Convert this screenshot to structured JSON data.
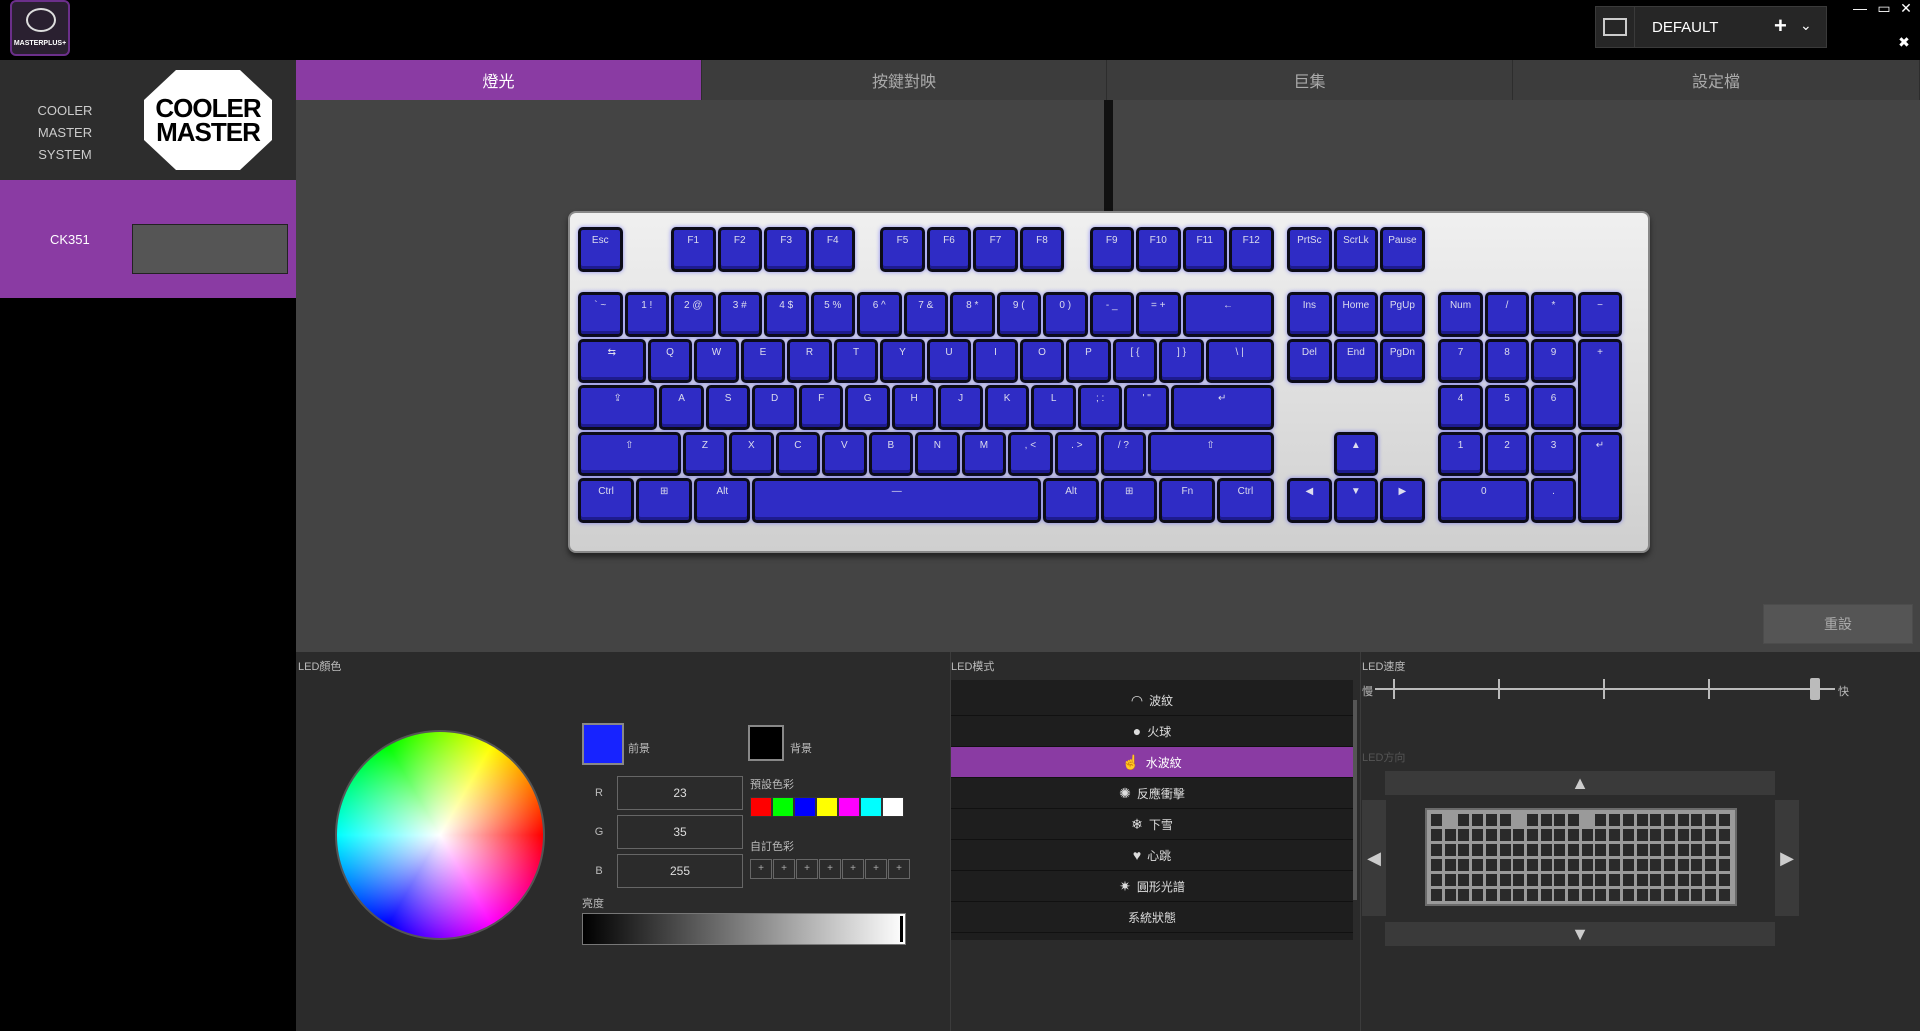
{
  "app": {
    "logo_text": "MASTERPLUS+"
  },
  "profile": {
    "name": "DEFAULT",
    "add": "+",
    "dropdown": "⌄"
  },
  "window": {
    "minimize": "—",
    "maximize": "▭",
    "close": "✕",
    "tools": "✖"
  },
  "sidebar": {
    "brand": {
      "text_line1": "COOLER MASTER",
      "text_line2": "SYSTEM",
      "logo_line1": "COOLER",
      "logo_line2": "MASTER"
    },
    "device": {
      "name": "CK351"
    }
  },
  "tabs": [
    {
      "label": "燈光"
    },
    {
      "label": "按鍵對映"
    },
    {
      "label": "巨集"
    },
    {
      "label": "設定檔"
    }
  ],
  "main": {
    "reset_label": "重設"
  },
  "keys": {
    "esc": "Esc",
    "f1": "F1",
    "f2": "F2",
    "f3": "F3",
    "f4": "F4",
    "f5": "F5",
    "f6": "F6",
    "f7": "F7",
    "f8": "F8",
    "f9": "F9",
    "f10": "F10",
    "f11": "F11",
    "f12": "F12",
    "prtsc": "PrtSc",
    "scrlk": "ScrLk",
    "pause": "Pause",
    "grave": "` ~",
    "n1": "1 !",
    "n2": "2 @",
    "n3": "3 #",
    "n4": "4 $",
    "n5": "5 %",
    "n6": "6 ^",
    "n7": "7 &",
    "n8": "8 *",
    "n9": "9 (",
    "n0": "0 )",
    "minus": "- _",
    "equal": "= +",
    "bksp": "←",
    "ins": "Ins",
    "home": "Home",
    "pgup": "PgUp",
    "num": "Num",
    "div": "/",
    "mul": "*",
    "sub": "−",
    "tab": "⇆",
    "q": "Q",
    "w": "W",
    "e": "E",
    "r": "R",
    "t": "T",
    "y": "Y",
    "u": "U",
    "i": "I",
    "o": "O",
    "p": "P",
    "lbr": "[ {",
    "rbr": "] }",
    "bsl": "\\ |",
    "del": "Del",
    "end": "End",
    "pgdn": "PgDn",
    "k7": "7",
    "k8": "8",
    "k9": "9",
    "add": "+",
    "caps": "⇪",
    "a": "A",
    "s": "S",
    "d": "D",
    "f": "F",
    "g": "G",
    "h": "H",
    "j": "J",
    "k": "K",
    "l": "L",
    "semi": "; :",
    "quote": "' \"",
    "enter": "↵",
    "k4": "4",
    "k5": "5",
    "k6": "6",
    "lshift": "⇧",
    "z": "Z",
    "x": "X",
    "c": "C",
    "v": "V",
    "b": "B",
    "n": "N",
    "m": "M",
    "comma": ", <",
    "dot": ". >",
    "slash": "/ ?",
    "rshift": "⇧",
    "up": "▲",
    "k1": "1",
    "k2": "2",
    "k3": "3",
    "kent": "↵",
    "lctrl": "Ctrl",
    "lwin": "⊞",
    "lalt": "Alt",
    "space": "—",
    "ralt": "Alt",
    "rwin": "⊞",
    "fn": "Fn",
    "rctrl": "Ctrl",
    "left": "◀",
    "down": "▼",
    "right": "▶",
    "k0": "0",
    "kdot": "."
  },
  "led_color": {
    "label": "LED顏色",
    "foreground_label": "前景",
    "background_label": "背景",
    "foreground_color": "#1723ff",
    "background_color": "#000000",
    "r_label": "R",
    "g_label": "G",
    "b_label": "B",
    "r": "23",
    "g": "35",
    "b": "255",
    "preset_label": "預設色彩",
    "preset_colors": [
      "#ff0000",
      "#00ff00",
      "#0000ff",
      "#ffff00",
      "#ff00ff",
      "#00ffff",
      "#ffffff"
    ],
    "custom_label": "自訂色彩",
    "custom_slot": "+",
    "brightness_label": "亮度",
    "brightness": 1.0
  },
  "led_mode": {
    "label": "LED模式",
    "items": [
      {
        "label": "波紋",
        "icon": "ripple-icon"
      },
      {
        "label": "火球",
        "icon": "fireball-icon"
      },
      {
        "label": "水波紋",
        "icon": "water-ripple-icon"
      },
      {
        "label": "反應衝擊",
        "icon": "reactive-icon"
      },
      {
        "label": "下雪",
        "icon": "snow-icon"
      },
      {
        "label": "心跳",
        "icon": "heart-icon"
      },
      {
        "label": "圓形光譜",
        "icon": "circle-spectrum-icon"
      },
      {
        "label": "系統狀態",
        "icon": ""
      }
    ],
    "active": "水波紋"
  },
  "led_speed": {
    "label": "LED速度",
    "slow": "慢",
    "fast": "快",
    "level": 5,
    "max": 5
  },
  "led_direction": {
    "label": "LED方向",
    "up": "▲",
    "down": "▼",
    "left": "◀",
    "right": "▶"
  }
}
